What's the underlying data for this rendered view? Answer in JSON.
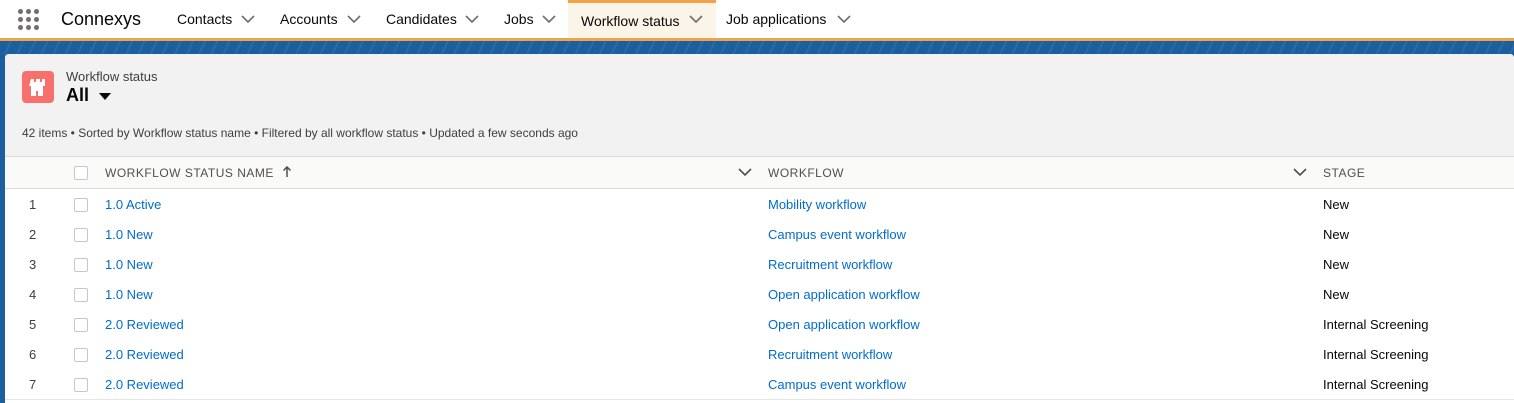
{
  "app": {
    "name": "Connexys"
  },
  "nav": {
    "tabs": [
      {
        "label": "Contacts"
      },
      {
        "label": "Accounts"
      },
      {
        "label": "Candidates"
      },
      {
        "label": "Jobs"
      },
      {
        "label": "Workflow status",
        "active": true
      },
      {
        "label": "Job applications"
      }
    ]
  },
  "header": {
    "object_type": "Workflow status",
    "list_view": "All",
    "summary": "42 items • Sorted by Workflow status name • Filtered by all workflow status • Updated a few seconds ago",
    "icon": "tower-icon",
    "icon_color": "#f7706c"
  },
  "table": {
    "columns": [
      {
        "label": "WORKFLOW STATUS NAME",
        "sort": "ascending"
      },
      {
        "label": "WORKFLOW"
      },
      {
        "label": "STAGE"
      }
    ],
    "rows": [
      {
        "num": "1",
        "name": "1.0 Active",
        "workflow": "Mobility workflow",
        "stage": "New"
      },
      {
        "num": "2",
        "name": "1.0 New",
        "workflow": "Campus event workflow",
        "stage": "New"
      },
      {
        "num": "3",
        "name": "1.0 New",
        "workflow": "Recruitment workflow",
        "stage": "New"
      },
      {
        "num": "4",
        "name": "1.0 New",
        "workflow": "Open application workflow",
        "stage": "New"
      },
      {
        "num": "5",
        "name": "2.0 Reviewed",
        "workflow": "Open application workflow",
        "stage": "Internal Screening"
      },
      {
        "num": "6",
        "name": "2.0 Reviewed",
        "workflow": "Recruitment workflow",
        "stage": "Internal Screening"
      },
      {
        "num": "7",
        "name": "2.0 Reviewed",
        "workflow": "Campus event workflow",
        "stage": "Internal Screening"
      }
    ]
  },
  "colors": {
    "link": "#006dcc",
    "accent": "#f4a24a",
    "brand_band": "#1b5f9e"
  }
}
